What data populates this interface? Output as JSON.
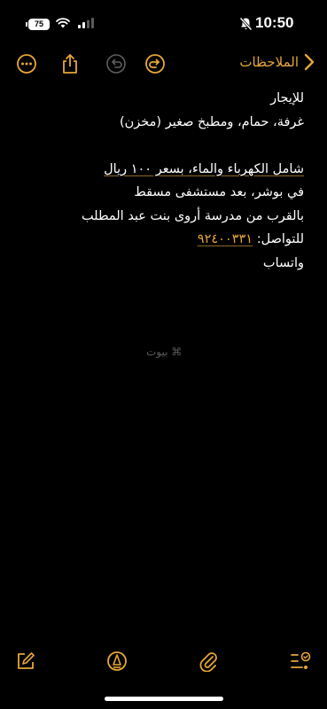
{
  "status_bar": {
    "time": "10:50",
    "battery": "75"
  },
  "toolbar": {
    "back_label": "الملاحظات"
  },
  "note": {
    "lines": [
      "للإيجار",
      "غرفة، حمام، ومطبخ صغير (مخزن)",
      "",
      "شامل الكهرباء والماء، بسعر ١٠٠ ريال",
      "في بوشر، بعد مستشفى مسقط",
      "بالقرب من مدرسة أروى بنت عبد المطلب",
      "للتواصل:",
      "واتساب"
    ],
    "phone": "٩٢٤٠٠٣٣١"
  },
  "watermark": "بيوت",
  "colors": {
    "accent": "#e6a63a",
    "background": "#000000",
    "text": "#ffffff",
    "icon_gray": "#8e8e93"
  }
}
